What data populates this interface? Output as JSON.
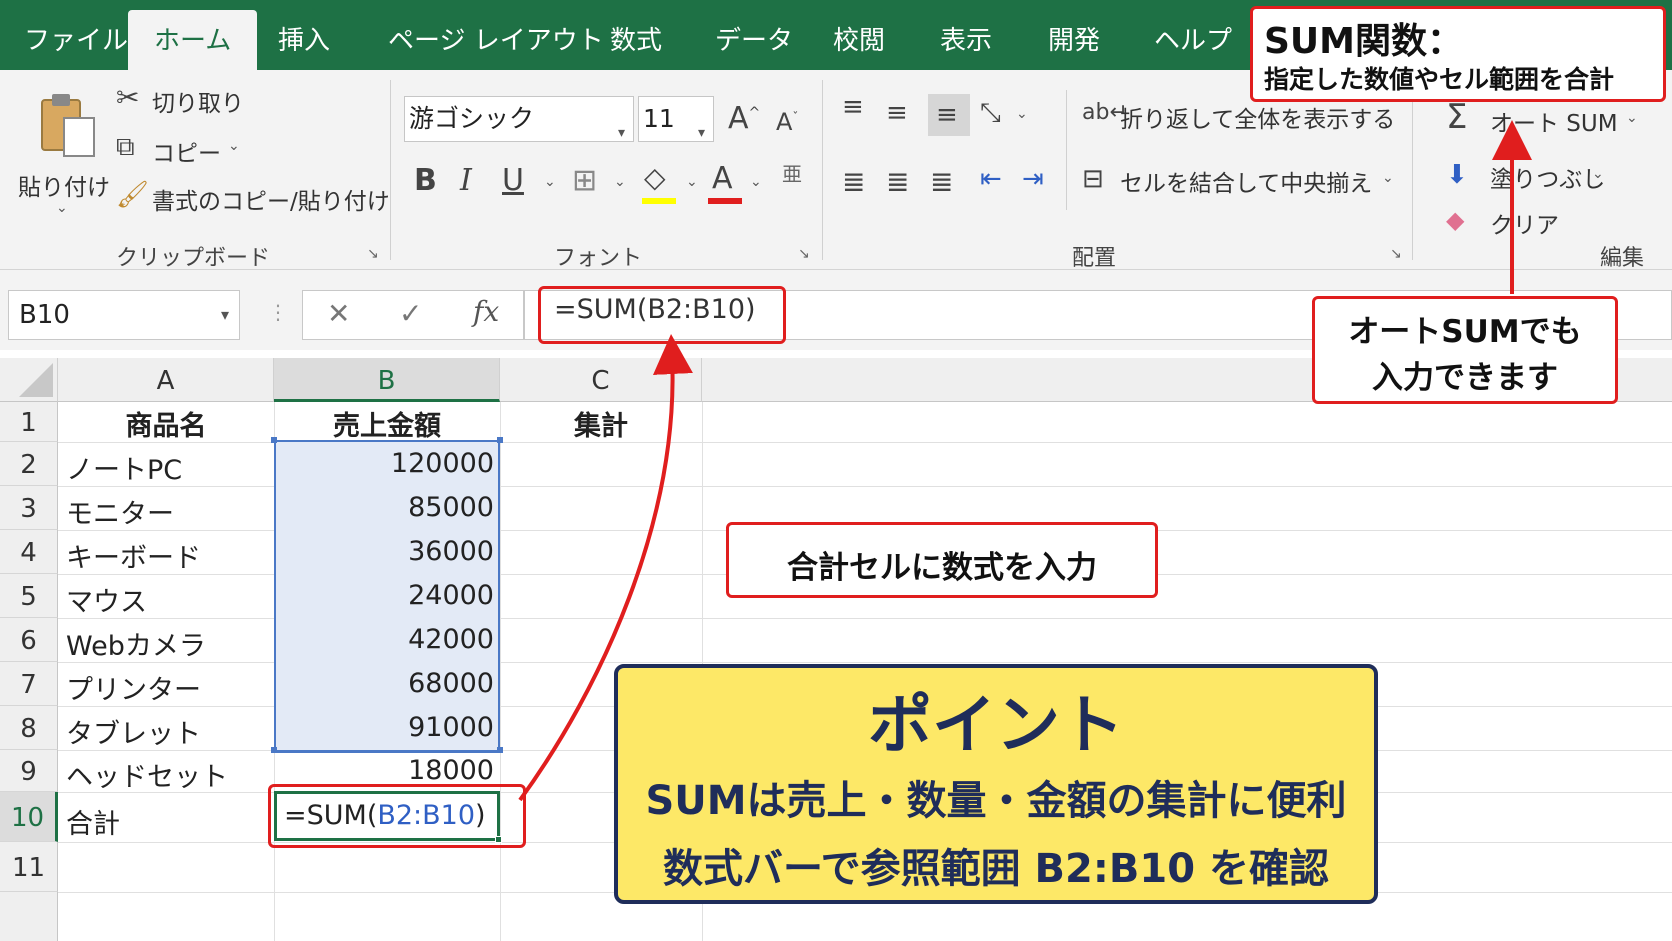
{
  "tabs": [
    "ファイル",
    "ホーム",
    "挿入",
    "ページ レイアウト",
    "数式",
    "データ",
    "校閲",
    "表示",
    "開発",
    "ヘルプ"
  ],
  "active_tab": "ホーム",
  "clipboard": {
    "paste": "貼り付け",
    "cut": "切り取り",
    "copy": "コピー",
    "format_painter": "書式のコピー/貼り付け",
    "group_label": "クリップボード"
  },
  "font": {
    "name": "游ゴシック",
    "size": "11",
    "bold": "B",
    "italic": "I",
    "underline": "U",
    "font_color": "A",
    "grow": "A",
    "shrink": "A",
    "group_label": "フォント"
  },
  "alignment": {
    "wrap_text": "折り返して全体を表示する",
    "merge_center": "セルを結合して中央揃え",
    "group_label": "配置"
  },
  "editing": {
    "autosum": "オート SUM",
    "fill": "塗りつぶし",
    "clear": "クリア",
    "group_label": "編集"
  },
  "formula_bar": {
    "name_box": "B10",
    "cancel": "✕",
    "enter": "✓",
    "fx": "fx",
    "formula": "=SUM(B2:B10)"
  },
  "columns": [
    "A",
    "B",
    "C"
  ],
  "rows": [
    "1",
    "2",
    "3",
    "4",
    "5",
    "6",
    "7",
    "8",
    "9",
    "10",
    "11"
  ],
  "headers": {
    "a": "商品名",
    "b": "売上金額",
    "c": "集計"
  },
  "items": [
    {
      "name": "ノートPC",
      "value": "120000"
    },
    {
      "name": "モニター",
      "value": "85000"
    },
    {
      "name": "キーボード",
      "value": "36000"
    },
    {
      "name": "マウス",
      "value": "24000"
    },
    {
      "name": "Webカメラ",
      "value": "42000"
    },
    {
      "name": "プリンター",
      "value": "68000"
    },
    {
      "name": "タブレット",
      "value": "91000"
    },
    {
      "name": "ヘッドセット",
      "value": "18000"
    }
  ],
  "total_row": {
    "label": "合計",
    "prefix": "=SUM(",
    "ref": "B2:B10",
    "suffix": ")"
  },
  "annotations": {
    "sum_title": "SUM関数：",
    "sum_desc": "指定した数値やセル範囲を合計",
    "autosum_note_line1": "オートSUMでも",
    "autosum_note_line2": "入力できます",
    "input_note": "合計セルに数式を入力",
    "point_title": "ポイント",
    "point_line1": "SUMは売上・数量・金額の集計に便利",
    "point_line2": "数式バーで参照範囲 B2:B10 を確認"
  },
  "colors": {
    "excel_green": "#1e7145",
    "annotation_red": "#e01e1e",
    "point_yellow": "#fde867",
    "point_border": "#1f2d5a",
    "ref_blue": "#2f5fc4"
  }
}
